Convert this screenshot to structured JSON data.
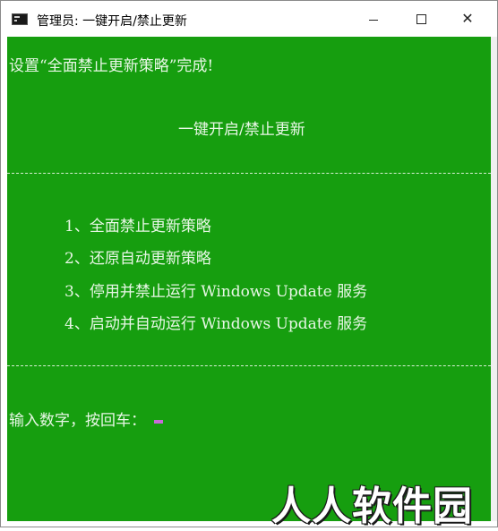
{
  "window": {
    "title": "管理员: 一键开启/禁止更新",
    "icon": "console-icon",
    "controls": {
      "minimize": "minimize",
      "maximize": "maximize",
      "close": "close"
    }
  },
  "console": {
    "background": "#169e0f",
    "text_color": "#e8f7e6",
    "status_line": "设置“全面禁止更新策略”完成!",
    "heading": "一键开启/禁止更新",
    "separator": "------------------------------------------------------------------------------------",
    "menu": [
      "1、全面禁止更新策略",
      "2、还原自动更新策略",
      "3、停用并禁止运行 Windows Update 服务",
      "4、启动并自动运行 Windows Update 服务"
    ],
    "prompt": "输入数字，按回车：",
    "cursor_color": "#c86ad8"
  },
  "watermark": "人人软件园"
}
